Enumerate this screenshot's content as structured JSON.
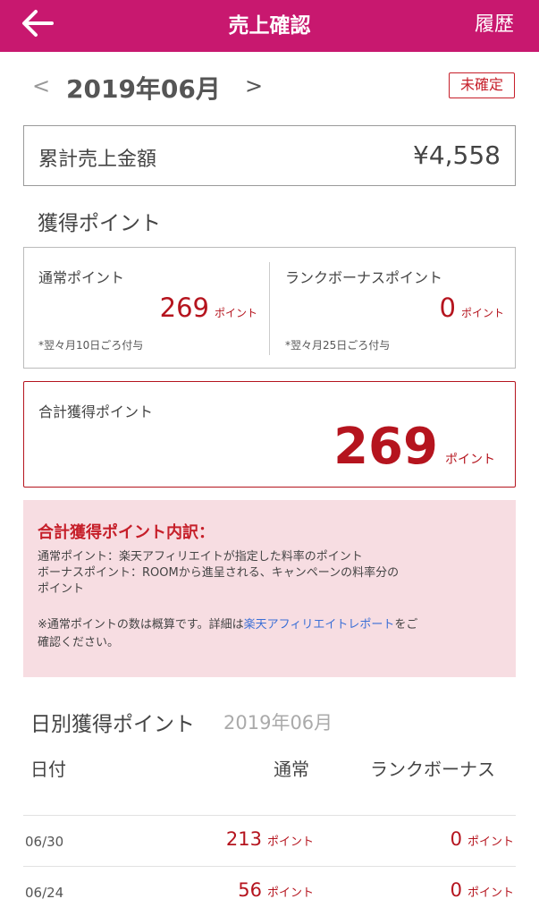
{
  "header": {
    "title": "売上確認",
    "history_label": "履歴"
  },
  "month_nav": {
    "prev": "<",
    "month": "2019年06月",
    "next": ">",
    "status_badge": "未確定"
  },
  "total_sales": {
    "label": "累計売上金額",
    "value": "¥4,558"
  },
  "earned_points": {
    "title": "獲得ポイント",
    "normal": {
      "label": "通常ポイント",
      "value": "269",
      "unit": "ポイント",
      "note": "*翌々月10日ごろ付与"
    },
    "rank_bonus": {
      "label": "ランクボーナスポイント",
      "value": "0",
      "unit": "ポイント",
      "note": "*翌々月25日ごろ付与"
    }
  },
  "total_points": {
    "label": "合計獲得ポイント",
    "value": "269",
    "unit": "ポイント"
  },
  "breakdown": {
    "title": "合計獲得ポイント内訳：",
    "line1": "通常ポイント：楽天アフィリエイトが指定した料率のポイント",
    "line2": "ボーナスポイント：ROOMから進呈される、キャンペーンの料率分の",
    "line3": "ポイント",
    "note_pre": "※通常ポイントの数は概算です。詳細は",
    "note_link": "楽天アフィリエイトレポート",
    "note_post": "をご",
    "note_line2": "確認ください。"
  },
  "daily": {
    "title": "日別獲得ポイント",
    "month": "2019年06月",
    "columns": {
      "date": "日付",
      "normal": "通常",
      "bonus": "ランクボーナス"
    },
    "rows": [
      {
        "date": "06/30",
        "normal": "213",
        "bonus": "0",
        "unit": "ポイント"
      },
      {
        "date": "06/24",
        "normal": "56",
        "bonus": "0",
        "unit": "ポイント"
      }
    ]
  }
}
